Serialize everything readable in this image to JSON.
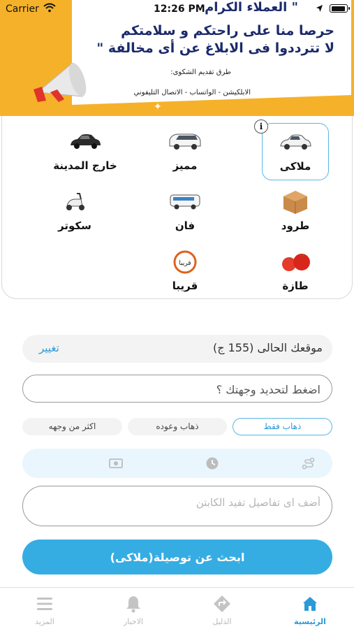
{
  "status_bar": {
    "carrier": "Carrier",
    "time": "12:26 PM"
  },
  "banner": {
    "title": "\" العملاء الكرام",
    "line2": "حرصا منا على راحتكم و سلامتكم",
    "line3": "لا تترددوا فى الابلاغ عن أى مخالفة \"",
    "methods_label": "طرق تقديم الشكوى:",
    "methods": "الابلكيشن - الواتساب - الاتصال التليفوني"
  },
  "services": [
    {
      "label": "ملاكى",
      "icon": "white-car-icon",
      "selected": true
    },
    {
      "label": "مميز",
      "icon": "minivan-icon",
      "selected": false
    },
    {
      "label": "خارج المدينة",
      "icon": "black-car-icon",
      "selected": false
    },
    {
      "label": "طرود",
      "icon": "parcel-box-icon",
      "selected": false
    },
    {
      "label": "فان",
      "icon": "van-icon",
      "selected": false
    },
    {
      "label": "سكوتر",
      "icon": "scooter-icon",
      "selected": false
    },
    {
      "label": "طازة",
      "icon": "tomatoes-icon",
      "selected": false
    },
    {
      "label": "قريبا",
      "icon": "coming-soon-icon",
      "badge": "قريبا",
      "selected": false
    }
  ],
  "form": {
    "current_location": "موقعك الحالى (155 ج)",
    "change_label": "تغيير",
    "destination_placeholder": "اضغط لتحديد وجهتك ؟",
    "trip_types": [
      "ذهاب فقط",
      "ذهاب وعوده",
      "اكثر من وجهه"
    ],
    "selected_trip": "ذهاب فقط",
    "notes_placeholder": "أضف اى تفاصيل تفيد الكابتن",
    "search_button": "ابحث عن توصيلة(ملاكى)"
  },
  "tabs": [
    {
      "label": "الرئيسية",
      "icon": "home-icon",
      "active": true
    },
    {
      "label": "الدليل",
      "icon": "directions-icon",
      "active": false
    },
    {
      "label": "الاخبار",
      "icon": "bell-icon",
      "active": false
    },
    {
      "label": "المزيد",
      "icon": "menu-icon",
      "active": false
    }
  ],
  "colors": {
    "accent": "#35ade3",
    "banner": "#f6b12a",
    "banner_text": "#1b2a6b"
  }
}
